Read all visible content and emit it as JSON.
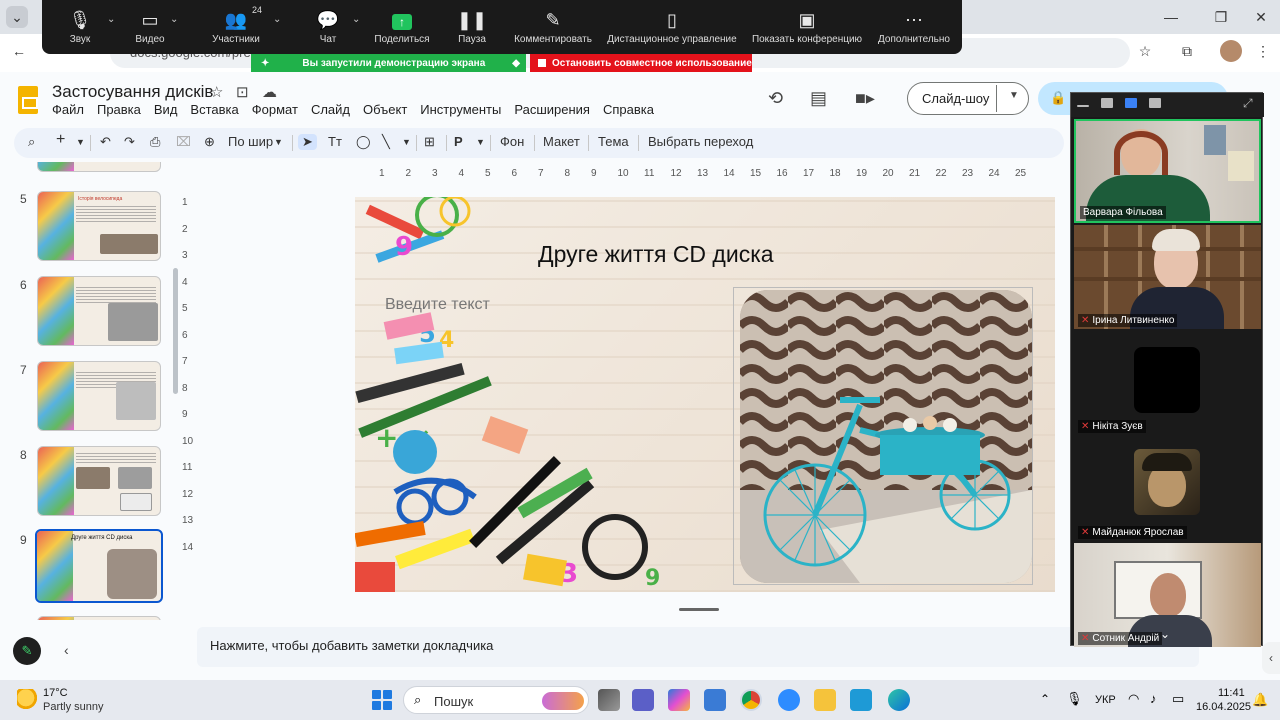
{
  "browser": {
    "url": "docs.google.com/prese"
  },
  "zoom_toolbar": {
    "items": [
      {
        "label": "Звук",
        "icon": "microphone-icon"
      },
      {
        "label": "Видео",
        "icon": "camera-icon"
      },
      {
        "label": "Участники",
        "icon": "participants-icon",
        "count": "24"
      },
      {
        "label": "Чат",
        "icon": "chat-icon"
      },
      {
        "label": "Поделиться",
        "icon": "share-screen-icon"
      },
      {
        "label": "Пауза",
        "icon": "pause-icon"
      },
      {
        "label": "Комментировать",
        "icon": "pencil-icon"
      },
      {
        "label": "Дистанционное управление",
        "icon": "mouse-icon"
      },
      {
        "label": "Показать конференцию",
        "icon": "show-meeting-icon"
      },
      {
        "label": "Дополнительно",
        "icon": "more-icon"
      }
    ],
    "banner_sharing": "Вы запустили демонстрацию экрана",
    "banner_stop": "Остановить совместное использование",
    "colors": {
      "green": "#20b14a",
      "red": "#e4121b"
    }
  },
  "slides_app": {
    "title": "Застосування дисків",
    "menu": [
      "Файл",
      "Правка",
      "Вид",
      "Вставка",
      "Формат",
      "Слайд",
      "Объект",
      "Инструменты",
      "Расширения",
      "Справка"
    ],
    "slideshow_label": "Слайд-шоу",
    "toolbar": {
      "zoom": "По шир",
      "background": "Фон",
      "layout": "Макет",
      "theme": "Тема",
      "transition": "Выбрать переход"
    },
    "thumbnails": [
      {
        "num": "5",
        "title": "Історія велосипеда"
      },
      {
        "num": "6"
      },
      {
        "num": "7"
      },
      {
        "num": "8"
      },
      {
        "num": "9",
        "title": "Друге життя CD диска",
        "selected": true
      }
    ],
    "ruler_top": [
      "1",
      "2",
      "3",
      "4",
      "5",
      "6",
      "7",
      "8",
      "9",
      "10",
      "11",
      "12",
      "13",
      "14",
      "15",
      "16",
      "17",
      "18",
      "19",
      "20",
      "21",
      "22",
      "23",
      "24",
      "25"
    ],
    "ruler_left": [
      "1",
      "2",
      "3",
      "4",
      "5",
      "6",
      "7",
      "8",
      "9",
      "10",
      "11",
      "12",
      "13",
      "14"
    ],
    "slide": {
      "title": "Друге життя CD диска",
      "placeholder": "Введите текст"
    },
    "notes_placeholder": "Нажмите, чтобы добавить заметки докладчика"
  },
  "gallery": {
    "participants": [
      {
        "name": "Варвара Фільова",
        "muted": false,
        "active": true
      },
      {
        "name": "Ірина Литвиненко",
        "muted": true
      },
      {
        "name": "Нікіта Зуєв",
        "muted": true
      },
      {
        "name": "Майданюк Ярослав",
        "muted": true
      },
      {
        "name": "Сотник Андрій",
        "muted": true
      }
    ]
  },
  "taskbar": {
    "weather_temp": "17°C",
    "weather_desc": "Partly sunny",
    "search_placeholder": "Пошук",
    "lang": "УКР",
    "time": "11:41",
    "date": "16.04.2025"
  }
}
